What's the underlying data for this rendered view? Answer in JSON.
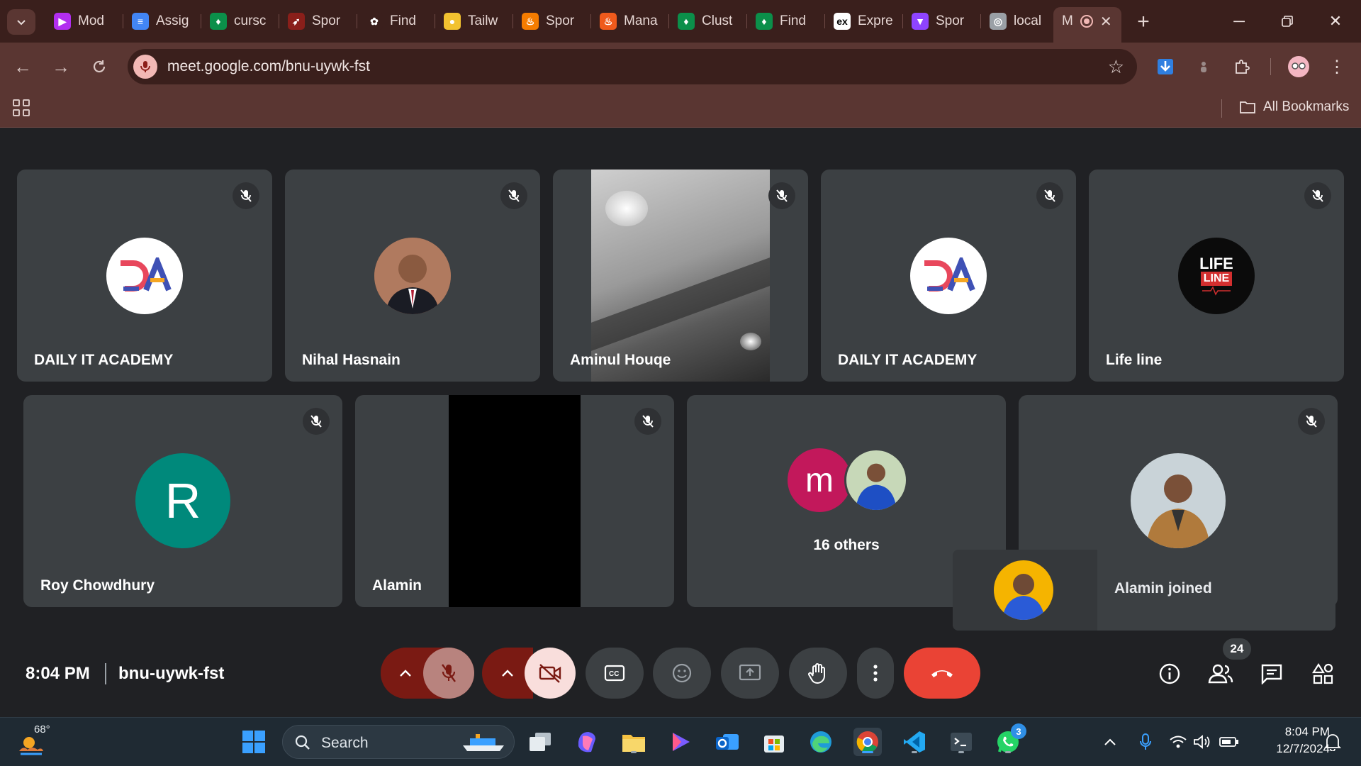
{
  "browser": {
    "tabs": [
      {
        "label": "Mod",
        "color": "#b22ef0",
        "glyph": "▶"
      },
      {
        "label": "Assig",
        "color": "#4285f4",
        "glyph": "≡"
      },
      {
        "label": "cursc",
        "color": "#0b8f4a",
        "glyph": "♦"
      },
      {
        "label": "Spor",
        "color": "#8a1f1a",
        "glyph": "➶"
      },
      {
        "label": "Find",
        "color": "#3a1f1c",
        "glyph": "✿"
      },
      {
        "label": "Tailw",
        "color": "#f2c230",
        "glyph": "●"
      },
      {
        "label": "Spor",
        "color": "#f57c00",
        "glyph": "♨"
      },
      {
        "label": "Mana",
        "color": "#ef5a1c",
        "glyph": "♨"
      },
      {
        "label": "Clust",
        "color": "#0b8f4a",
        "glyph": "♦"
      },
      {
        "label": "Find",
        "color": "#0b8f4a",
        "glyph": "♦"
      },
      {
        "label": "Expre",
        "color": "#ffffff",
        "glyph": "ex"
      },
      {
        "label": "Spor",
        "color": "#8e44ff",
        "glyph": "▼"
      },
      {
        "label": "local",
        "color": "#9aa0a6",
        "glyph": "◎"
      }
    ],
    "active_tab_label": "M",
    "url": "meet.google.com/bnu-uywk-fst",
    "all_bookmarks": "All Bookmarks"
  },
  "meet": {
    "tiles_row1": [
      {
        "name": "DAILY IT ACADEMY",
        "avatar": "da-logo"
      },
      {
        "name": "Nihal Hasnain",
        "avatar": "photo"
      },
      {
        "name": "Aminul Houqe",
        "avatar": "video"
      },
      {
        "name": "DAILY IT ACADEMY",
        "avatar": "da-logo"
      },
      {
        "name": "Life line",
        "avatar": "lifeline-logo"
      }
    ],
    "tiles_row2": [
      {
        "name": "Roy Chowdhury",
        "avatar_letter": "R",
        "avatar_color": "#00897b"
      },
      {
        "name": "Alamin",
        "avatar": "video-black"
      },
      {
        "name": "16 others",
        "avatar_letter": "m",
        "avatar_color": "#c2185b"
      },
      {
        "name": "",
        "avatar": "photo"
      }
    ],
    "lifeline_text_1": "LIFE",
    "lifeline_text_2": "LINE",
    "toast": "Alamin joined",
    "time": "8:04 PM",
    "meeting_code": "bnu-uywk-fst",
    "people_count": "24",
    "accent_leave": "#ea4335"
  },
  "taskbar": {
    "weather": "68°",
    "search_label": "Search",
    "clock_time": "8:04 PM",
    "clock_date": "12/7/2024",
    "whatsapp_badge": "3"
  }
}
